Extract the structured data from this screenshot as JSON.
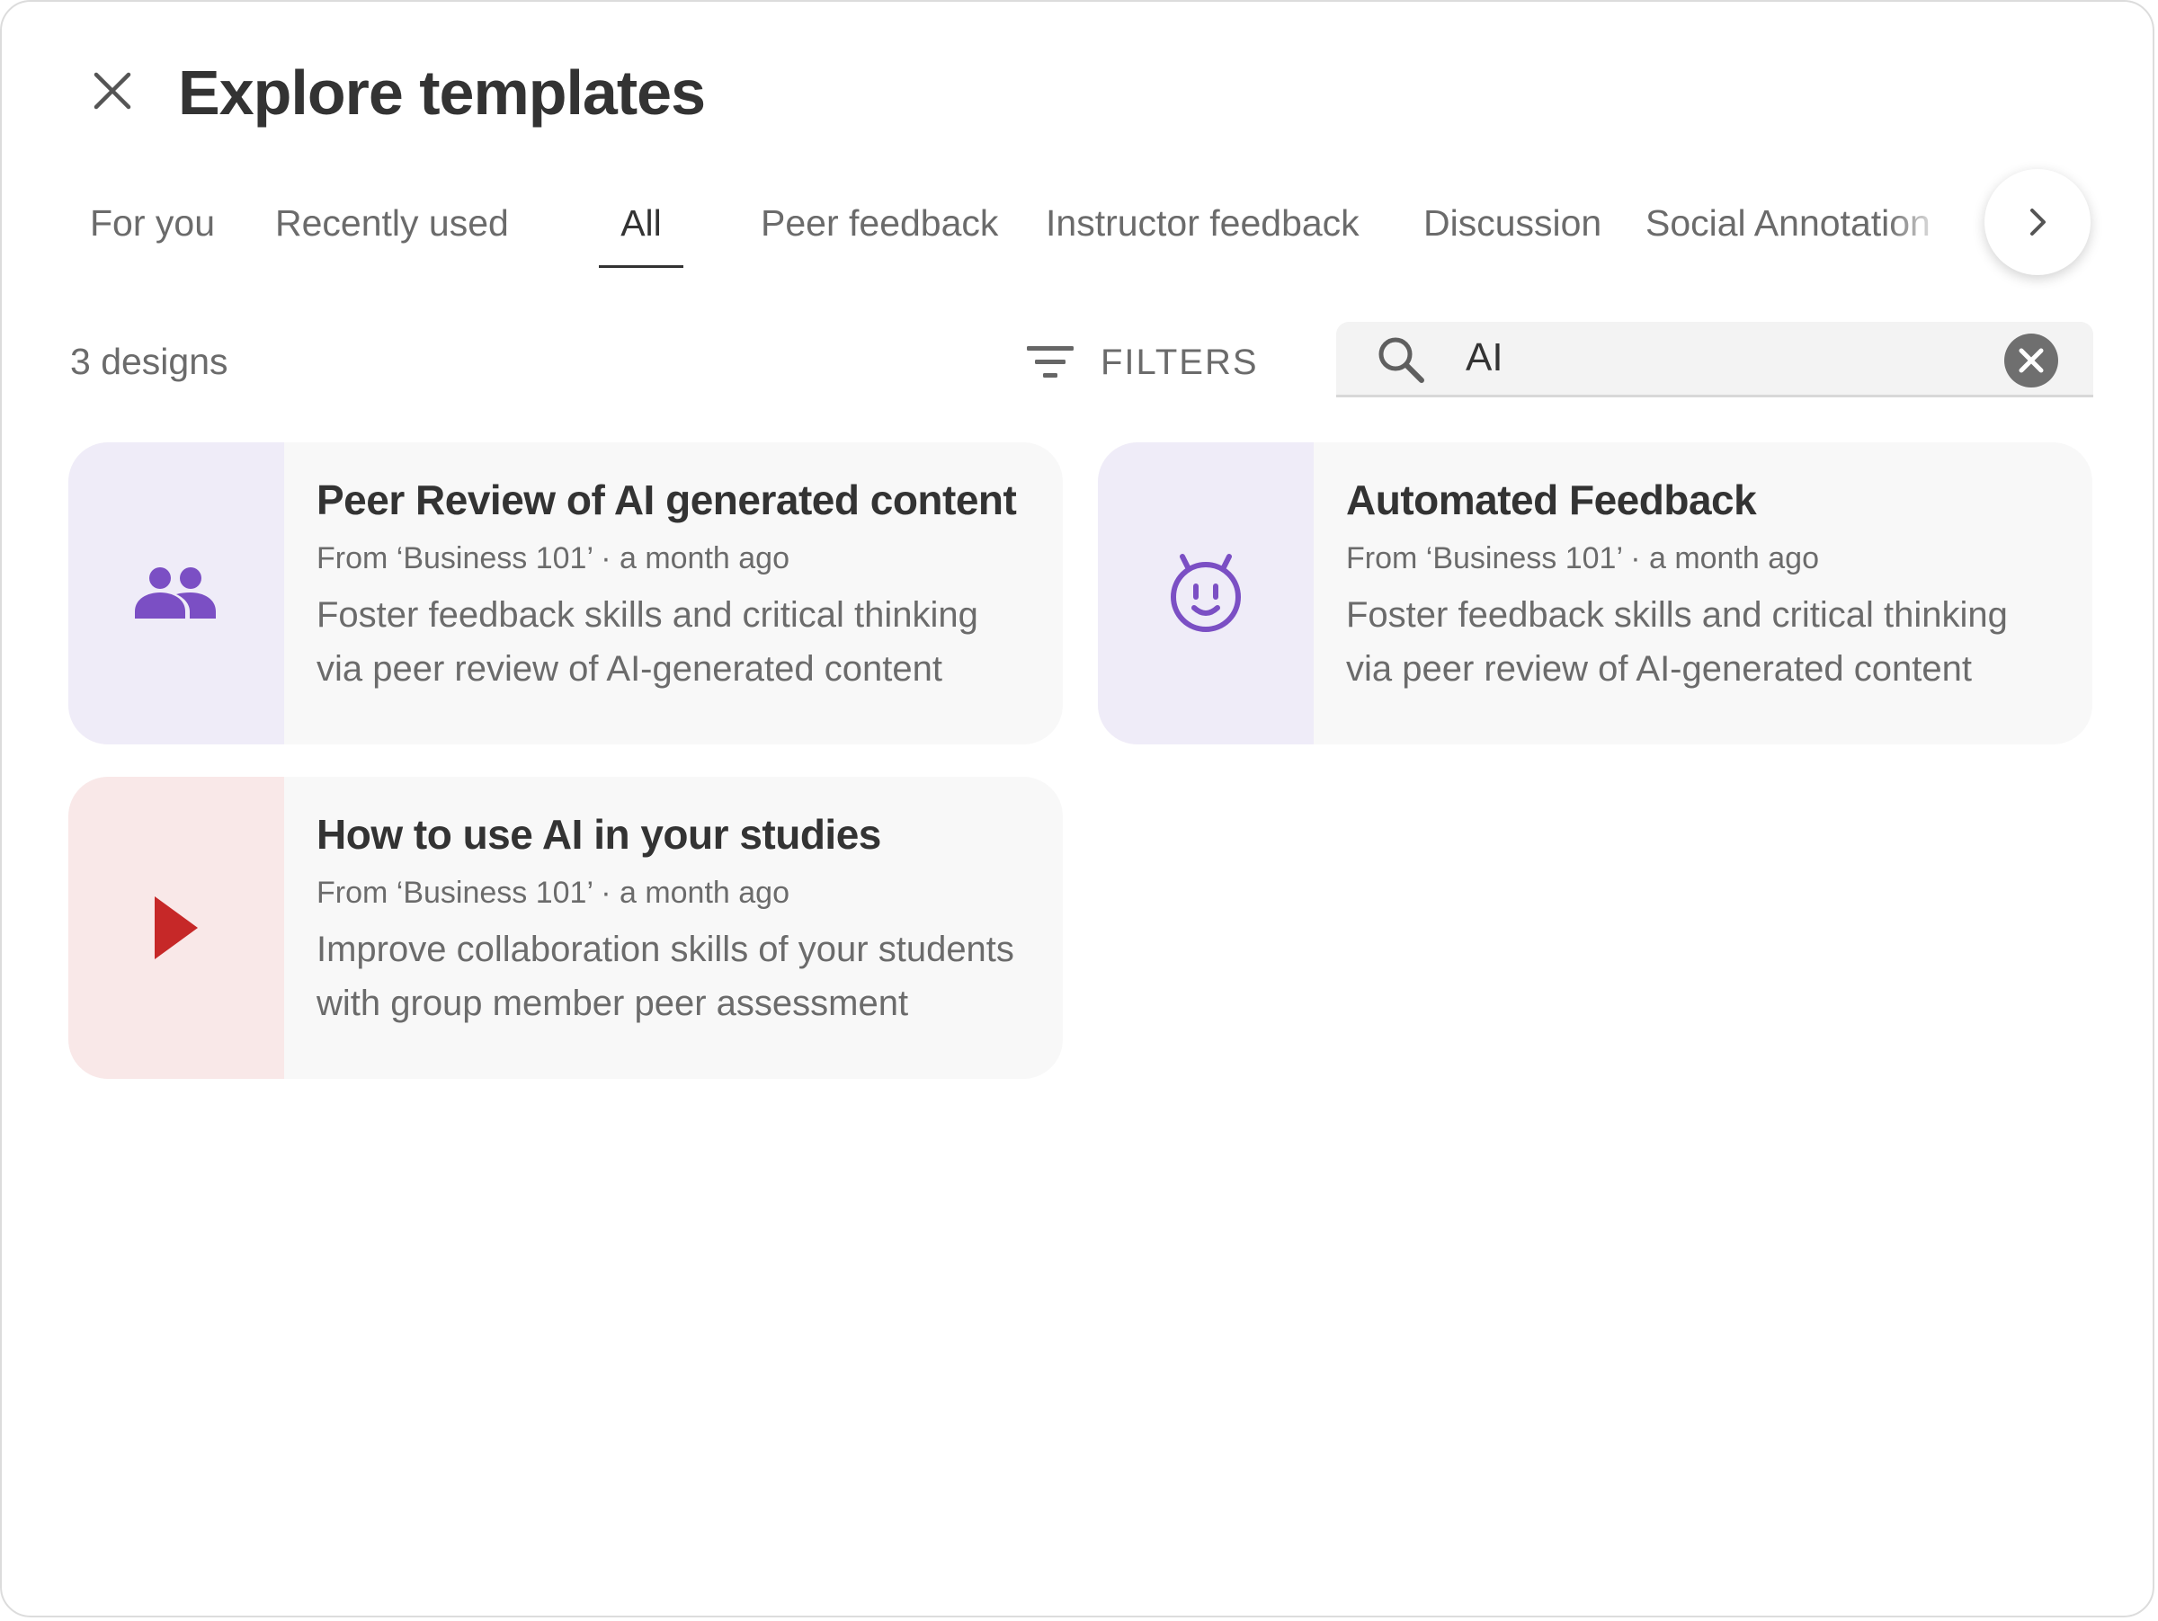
{
  "dialog": {
    "title": "Explore templates",
    "close_icon": "close-icon"
  },
  "tabs": [
    {
      "label": "For you",
      "active": false
    },
    {
      "label": "Recently used",
      "active": false
    },
    {
      "label": "All",
      "active": true
    },
    {
      "label": "Peer feedback",
      "active": false
    },
    {
      "label": "Instructor feedback",
      "active": false
    },
    {
      "label": "Discussion",
      "active": false
    },
    {
      "label": "Social Annotation",
      "active": false
    }
  ],
  "tabs_next_icon": "chevron-right-icon",
  "toolbar": {
    "count": "3 designs",
    "filters_label": "FILTERS",
    "filters_icon": "filter-list-icon"
  },
  "search": {
    "value": "AI",
    "search_icon": "search-icon",
    "clear_icon": "clear-circle-icon"
  },
  "templates": [
    {
      "title": "Peer Review of AI generated content",
      "source": "From ‘Business 101’ · a month ago",
      "description": "Foster feedback skills and critical thinking via peer review of AI-generated content",
      "icon": "group-icon",
      "thumb_color": "#efecf8",
      "icon_color": "#7b4fc4"
    },
    {
      "title": "Automated Feedback",
      "source": "From ‘Business 101’ · a month ago",
      "description": "Foster feedback skills and critical thinking via peer review of AI-generated content",
      "icon": "robot-face-icon",
      "thumb_color": "#efecf8",
      "icon_color": "#7b4fc4"
    },
    {
      "title": "How to use AI in your studies",
      "source": "From ‘Business 101’ · a month ago",
      "description": "Improve collaboration skills of your students with group member peer assessment",
      "icon": "play-icon",
      "thumb_color": "#f9e8e8",
      "icon_color": "#c62828"
    }
  ]
}
